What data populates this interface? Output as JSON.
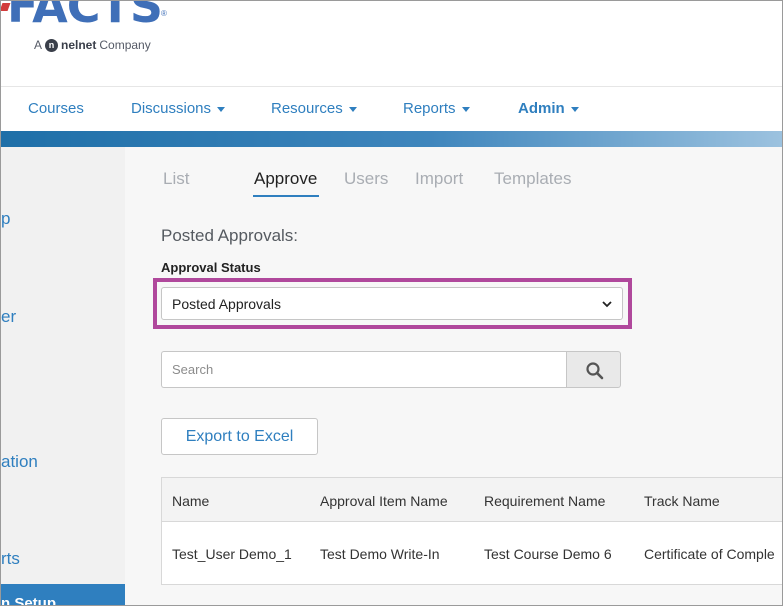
{
  "header": {
    "logo_text": "FACTS",
    "logo_sub_prefix": "A",
    "logo_sub_brand": "nelnet",
    "logo_sub_suffix": "Company"
  },
  "nav": {
    "items": [
      {
        "label": "Courses",
        "dropdown": false
      },
      {
        "label": "Discussions",
        "dropdown": true
      },
      {
        "label": "Resources",
        "dropdown": true
      },
      {
        "label": "Reports",
        "dropdown": true
      },
      {
        "label": "Admin",
        "dropdown": true
      }
    ]
  },
  "sidebar": {
    "items": [
      "p",
      "er",
      "ation",
      "rts"
    ],
    "active_label": "n Setup"
  },
  "tabs": [
    {
      "label": "List",
      "active": false
    },
    {
      "label": "Approve",
      "active": true
    },
    {
      "label": "Users",
      "active": false
    },
    {
      "label": "Import",
      "active": false
    },
    {
      "label": "Templates",
      "active": false
    }
  ],
  "main": {
    "section_title": "Posted Approvals:",
    "status_label": "Approval Status",
    "status_value": "Posted Approvals",
    "search_placeholder": "Search",
    "export_label": "Export to Excel"
  },
  "table": {
    "headers": [
      "Name",
      "Approval Item Name",
      "Requirement Name",
      "Track Name"
    ],
    "rows": [
      [
        "Test_User Demo_1",
        "Test Demo Write-In",
        "Test Course Demo 6",
        "Certificate of Comple"
      ]
    ]
  },
  "colors": {
    "link": "#2f7fbf",
    "highlight": "#b0489c",
    "logo": "#3f6fb8"
  }
}
